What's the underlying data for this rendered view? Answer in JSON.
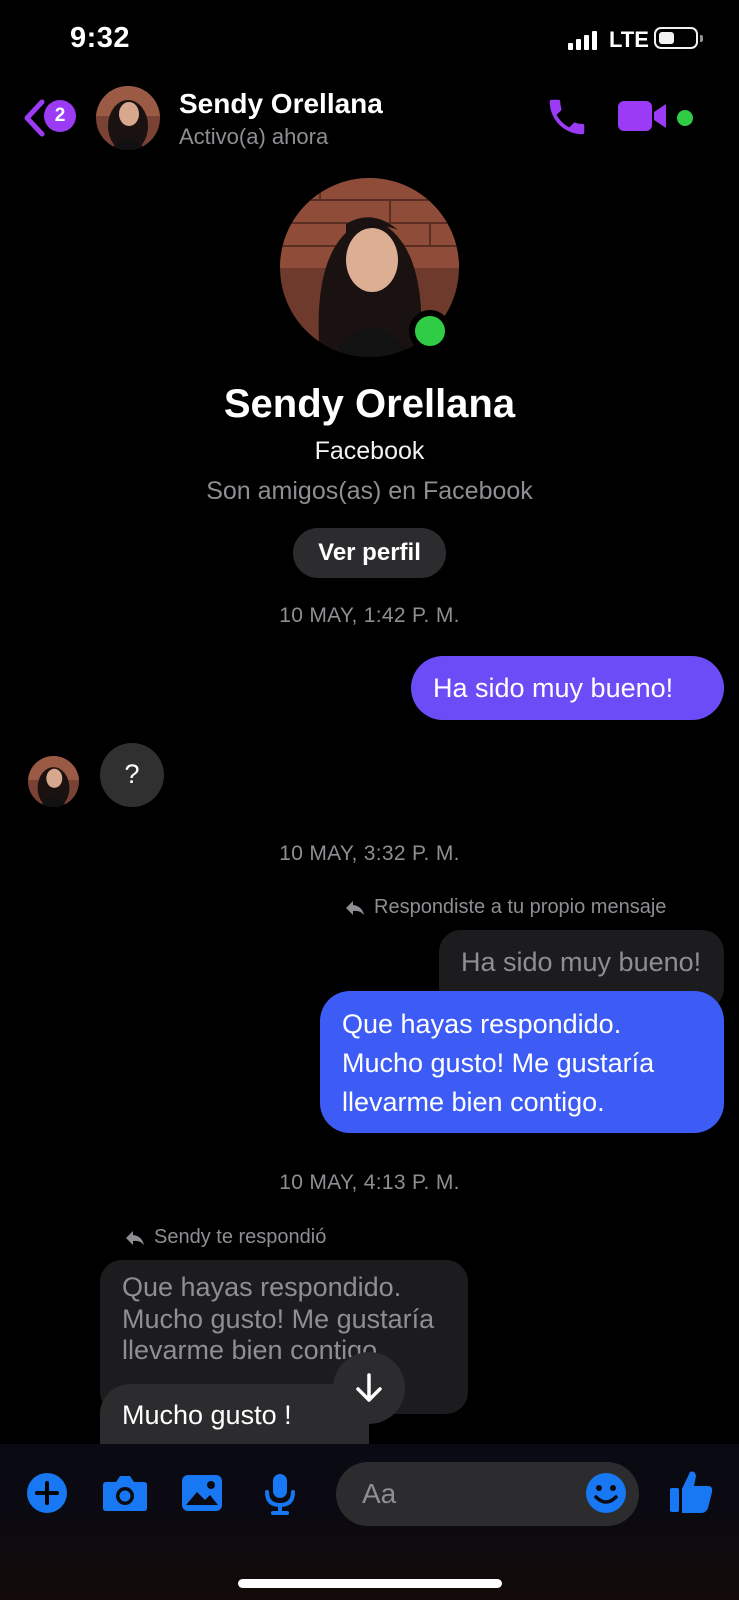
{
  "status_bar": {
    "time": "9:32",
    "network": "LTE"
  },
  "header": {
    "unread_count": "2",
    "contact_name": "Sendy Orellana",
    "contact_status": "Activo(a) ahora"
  },
  "profile": {
    "name": "Sendy Orellana",
    "platform": "Facebook",
    "relationship": "Son amigos(as) en Facebook",
    "view_profile_label": "Ver perfil"
  },
  "messages": {
    "timestamp_1": "10 MAY, 1:42 P. M.",
    "outgoing_1": "Ha sido muy bueno!",
    "incoming_1": "?",
    "timestamp_2": "10 MAY, 3:32 P. M.",
    "reply_note_out": "Respondiste a tu propio mensaje",
    "quoted_out": "Ha sido muy bueno!",
    "outgoing_2": "Que hayas respondido. Mucho gusto! Me gustaría llevarme bien contigo.",
    "timestamp_3": "10 MAY, 4:13 P. M.",
    "reply_note_in": "Sendy te respondió",
    "quoted_in": "Que hayas respondido. Mucho gusto! Me gustaría llevarme bien contigo.",
    "incoming_2": "Mucho gusto !"
  },
  "composer": {
    "placeholder": "Aa"
  },
  "colors": {
    "accent_purple": "#9b3bf5",
    "outgoing_purple": "#6b4cf6",
    "outgoing_blue": "#3d5cf5",
    "composer_blue": "#1877f2",
    "online_green": "#31cc46"
  },
  "icons": [
    "back-chevron-icon",
    "phone-icon",
    "video-camera-icon",
    "reply-arrow-icon",
    "arrow-down-icon",
    "plus-icon",
    "camera-icon",
    "image-icon",
    "microphone-icon",
    "emoji-icon",
    "thumbs-up-icon"
  ]
}
